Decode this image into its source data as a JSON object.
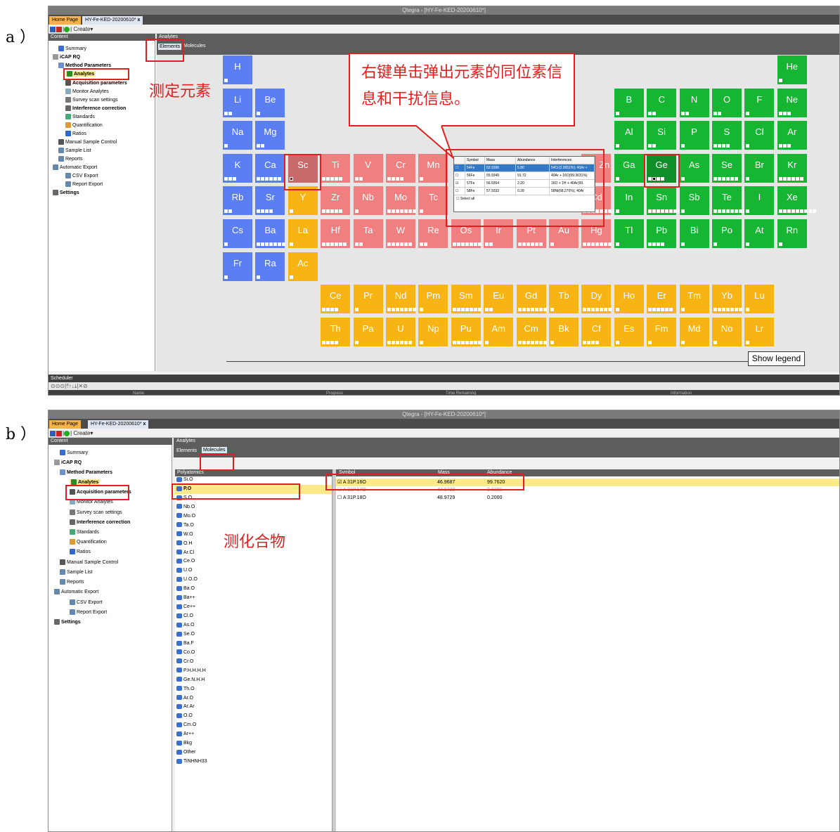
{
  "labels": {
    "a": "a ）",
    "b": "b ）"
  },
  "app": {
    "title": "Qtegra - [HY-Fe-KED-20200610*]",
    "home_tab": "Home Page",
    "doc_tab": "HY-Fe-KED-20200610*",
    "close": "x",
    "create": "Create▾"
  },
  "tree": {
    "header": "Content",
    "items": [
      "Summary",
      "iCAP RQ",
      "Method Parameters",
      "Analytes",
      "Acquisition parameters",
      "Monitor Analytes",
      "Survey scan settings",
      "Interference correction",
      "Standards",
      "Quantification",
      "Ratios",
      "Manual Sample Control",
      "Sample List",
      "Reports",
      "Automatic Export",
      "CSV Export",
      "Report Export",
      "Settings"
    ]
  },
  "analytes": {
    "header": "Analytes",
    "tab_elements": "Elements",
    "tab_molecules": "Molecules"
  },
  "annotations": {
    "callout": "右键单击弹出元素的同位素信息和干扰信息。",
    "element_label": "测定元素",
    "molecule_label": "测化合物"
  },
  "periodic": {
    "row1": [
      "H",
      "He"
    ],
    "row2": [
      "Li",
      "Be",
      "B",
      "C",
      "N",
      "O",
      "F",
      "Ne"
    ],
    "row3": [
      "Na",
      "Mg",
      "Al",
      "Si",
      "P",
      "S",
      "Cl",
      "Ar"
    ],
    "row4": [
      "K",
      "Ca",
      "Sc",
      "Ti",
      "V",
      "Cr",
      "Mn",
      "Ga",
      "Ge",
      "As",
      "Se",
      "Br",
      "Kr"
    ],
    "row5": [
      "Rb",
      "Sr",
      "Y",
      "Zr",
      "Nb",
      "Mo",
      "Tc",
      "Cd",
      "In",
      "Sn",
      "Sb",
      "Te",
      "I",
      "Xe"
    ],
    "row6": [
      "Cs",
      "Ba",
      "La",
      "Hf",
      "Ta",
      "W",
      "Re",
      "Os",
      "Ir",
      "Pt",
      "Au",
      "Hg",
      "Tl",
      "Pb",
      "Bi",
      "Po",
      "At",
      "Rn"
    ],
    "row7": [
      "Fr",
      "Ra",
      "Ac"
    ],
    "lanth": [
      "Ce",
      "Pr",
      "Nd",
      "Pm",
      "Sm",
      "Eu",
      "Gd",
      "Tb",
      "Dy",
      "Ho",
      "Er",
      "Tm",
      "Yb",
      "Lu"
    ],
    "actin": [
      "Th",
      "Pa",
      "U",
      "Np",
      "Pu",
      "Am",
      "Cm",
      "Bk",
      "Cf",
      "Es",
      "Fm",
      "Md",
      "No",
      "Lr"
    ],
    "partial": "Zn"
  },
  "popup": {
    "headers": [
      "Symbol",
      "Mass",
      "Abundance",
      "Interferences"
    ],
    "rows": [
      [
        "54Fe",
        "53.9396",
        "5.80",
        "54Cr(2.3651%); 40Ar +"
      ],
      [
        "56Fe",
        "55.9349",
        "91.72",
        "40Ar + 16O(99.3631%)"
      ],
      [
        "57Fe",
        "56.9354",
        "2.20",
        "16O + 1H + 40Ar(99."
      ],
      [
        "58Fe",
        "57.9333",
        "0.28",
        "58Ni(68.270%); 40Ar"
      ]
    ],
    "select_all": "Select all"
  },
  "show_legend": "Show legend",
  "scheduler": {
    "title": "Scheduler",
    "cols": [
      "Name",
      "Progress",
      "Time Remaining",
      "Information"
    ]
  },
  "molecules": {
    "header": "Polyatomics",
    "items": [
      "Si.O",
      "P.O",
      "S.O",
      "Nb.O",
      "Mo.O",
      "Ta.O",
      "W.O",
      "O.H",
      "Ar.Cl",
      "Ce.O",
      "U.O",
      "U.O.O",
      "Ba.O",
      "Ba++",
      "Ce++",
      "Cl.O",
      "As.O",
      "Se.O",
      "Ba.F",
      "Co.O",
      "Cr.O",
      "P.H.H.H.H",
      "Ge.N.H.H",
      "Th.O",
      "Ar.O",
      "Ar.Ar",
      "O.O",
      "Cm.O",
      "Ar++",
      "Bkg",
      "Other",
      "TiNHNH33"
    ],
    "iso_headers": [
      "Symbol",
      "Mass",
      "Abundance"
    ],
    "isotopes": [
      [
        "31P.16O",
        "46.9687",
        "99.7620"
      ],
      [
        "31P.17O",
        "47.9729",
        "0.0380"
      ],
      [
        "31P.18O",
        "48.9729",
        "0.2000"
      ]
    ]
  }
}
